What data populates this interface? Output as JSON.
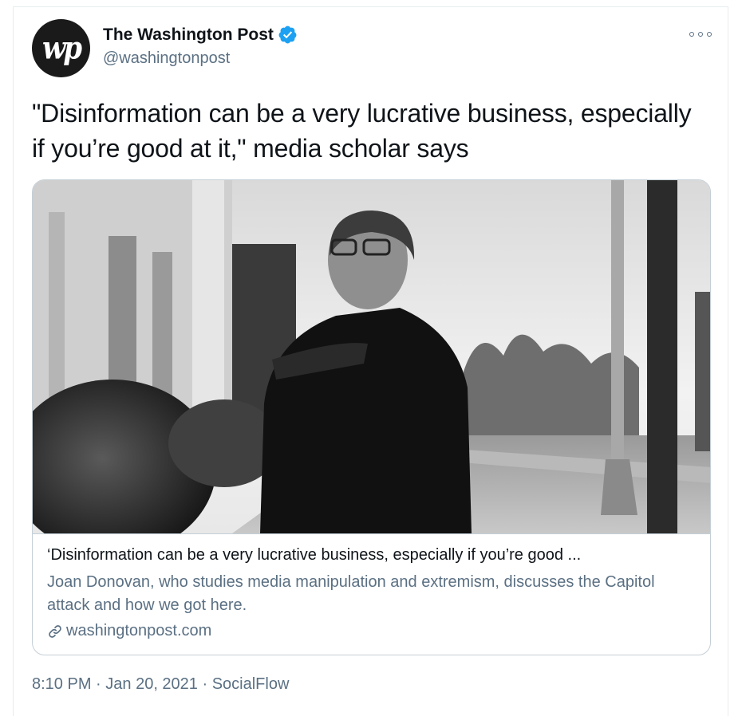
{
  "tweet": {
    "author_name": "The Washington Post",
    "author_handle": "@washingtonpost",
    "avatar_text": "wp",
    "text": "\"Disinformation can be a very lucrative business, especially if you’re good at it,\" media scholar says",
    "card": {
      "title": "‘Disinformation can be a very lucrative business, especially if you’re good ...",
      "description": "Joan Donovan, who studies media manipulation and extremism, discusses the Capitol attack and how we got here.",
      "domain": "washingtonpost.com"
    },
    "time": "8:10 PM",
    "separator": " · ",
    "date": "Jan 20, 2021",
    "source": "SocialFlow"
  },
  "colors": {
    "text_primary": "#0f1419",
    "text_secondary": "#5b7083",
    "verified_blue": "#1da1f2",
    "border": "#c4cfd6"
  },
  "icons": {
    "verified": "verified-badge-icon",
    "more": "more-options-icon",
    "link": "link-icon"
  }
}
